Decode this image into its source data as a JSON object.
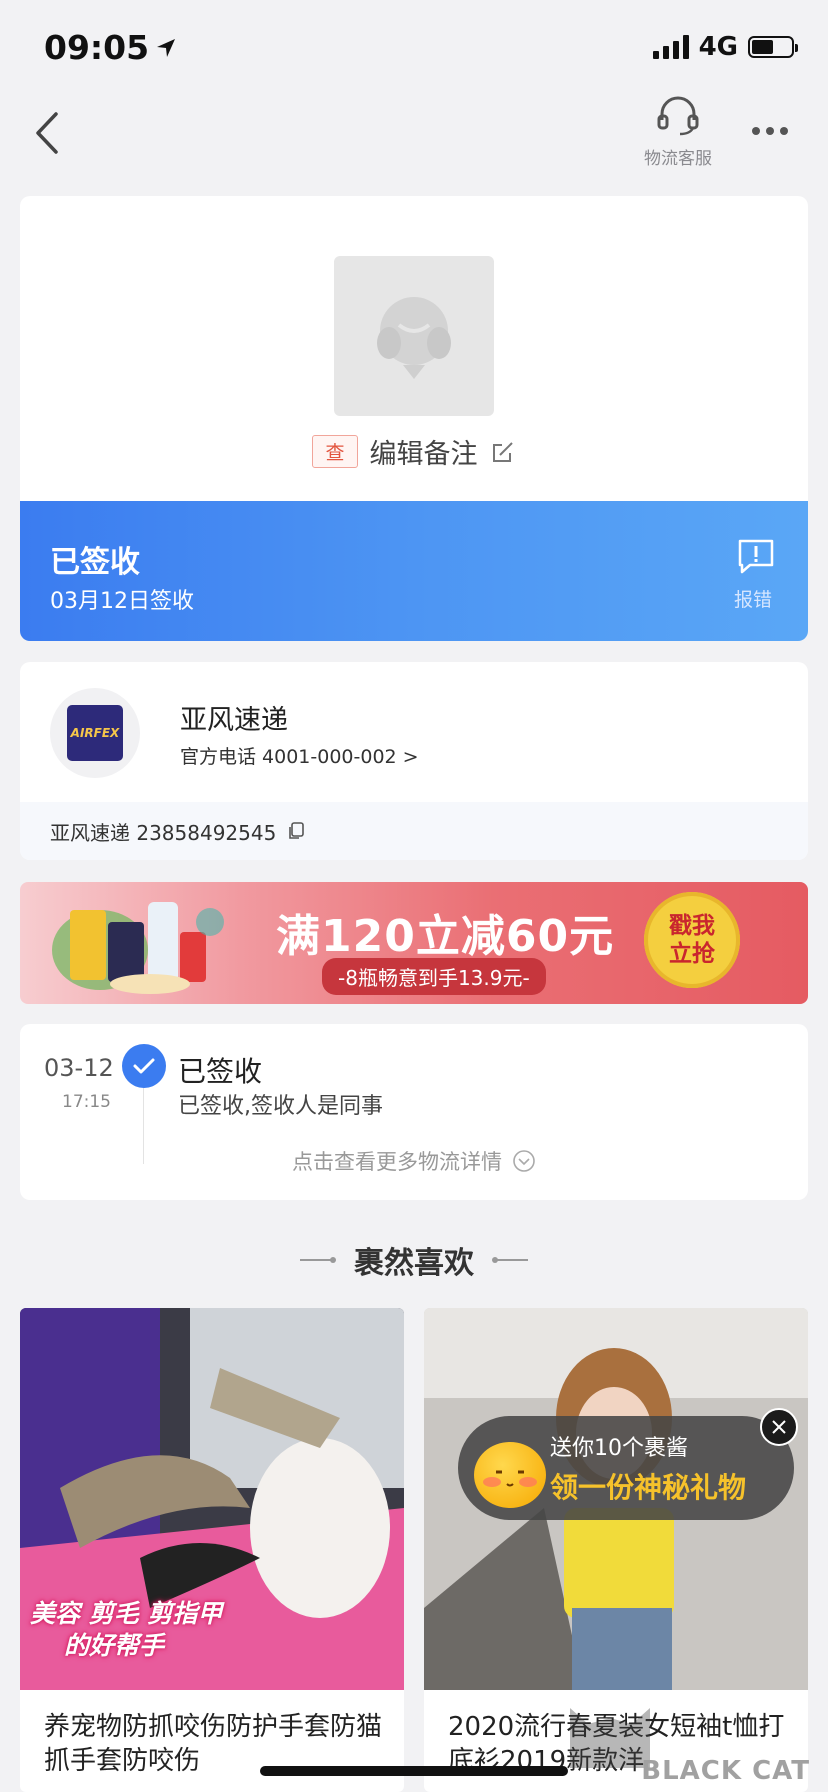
{
  "status_bar": {
    "time": "09:05",
    "network": "4G"
  },
  "nav": {
    "customer_service_label": "物流客服"
  },
  "package": {
    "tag": "查",
    "remark_label": "编辑备注",
    "status_title": "已签收",
    "status_date": "03月12日签收",
    "report_label": "报错"
  },
  "courier": {
    "name": "亚风速递",
    "phone": "官方电话 4001-000-002 >",
    "tracking": "亚风速递 23858492545",
    "logo_text": "AIRFEX"
  },
  "banner": {
    "headline": "满120立减60元",
    "subline": "-8瓶畅意到手13.9元-",
    "cta": "戳我立抢"
  },
  "timeline": {
    "date": "03-12",
    "time": "17:15",
    "title": "已签收",
    "desc": "已签收,签收人是同事",
    "more": "点击查看更多物流详情"
  },
  "recommend": {
    "title": "裹然喜欢",
    "items": [
      {
        "title": "养宠物防抓咬伤防护手套防猫抓手套防咬伤",
        "overlay_line1": "美容 剪毛 剪指甲",
        "overlay_line2": "的好帮手"
      },
      {
        "title": "2020流行春夏装女短袖t恤打底衫2019新款洋"
      }
    ]
  },
  "gift_popup": {
    "small": "送你10个裹酱",
    "big": "领一份神秘礼物"
  },
  "watermark": {
    "text": "BLACK CAT"
  },
  "colors": {
    "accent_blue": "#3b7cf0",
    "tag_red": "#e2553f",
    "gift_yellow": "#f6c22b"
  }
}
